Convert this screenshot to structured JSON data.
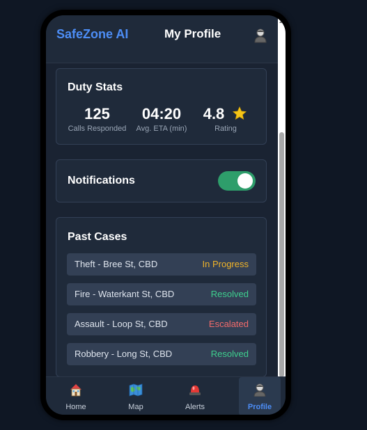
{
  "header": {
    "brand": "SafeZone AI",
    "title": "My Profile",
    "profile_icon": "person-icon"
  },
  "duty_stats": {
    "title": "Duty Stats",
    "stats": [
      {
        "value": "125",
        "label": "Calls Responded"
      },
      {
        "value": "04:20",
        "label": "Avg. ETA (min)"
      },
      {
        "value": "4.8",
        "label": "Rating",
        "icon": "star-icon"
      }
    ]
  },
  "notifications": {
    "label": "Notifications",
    "enabled": true
  },
  "past_cases": {
    "title": "Past Cases",
    "items": [
      {
        "name": "Theft - Bree St, CBD",
        "status": "In Progress",
        "color": "#f0b429"
      },
      {
        "name": "Fire - Waterkant St, CBD",
        "status": "Resolved",
        "color": "#3ecf8e"
      },
      {
        "name": "Assault - Loop St, CBD",
        "status": "Escalated",
        "color": "#f36b6b"
      },
      {
        "name": "Robbery - Long St, CBD",
        "status": "Resolved",
        "color": "#3ecf8e"
      }
    ]
  },
  "nav": {
    "items": [
      {
        "label": "Home",
        "icon": "home-icon",
        "active": false
      },
      {
        "label": "Map",
        "icon": "map-icon",
        "active": false
      },
      {
        "label": "Alerts",
        "icon": "siren-icon",
        "active": false
      },
      {
        "label": "Profile",
        "icon": "person-icon",
        "active": true
      }
    ]
  },
  "colors": {
    "accent": "#4d8ef7",
    "toggle_on": "#2e9e6b"
  }
}
